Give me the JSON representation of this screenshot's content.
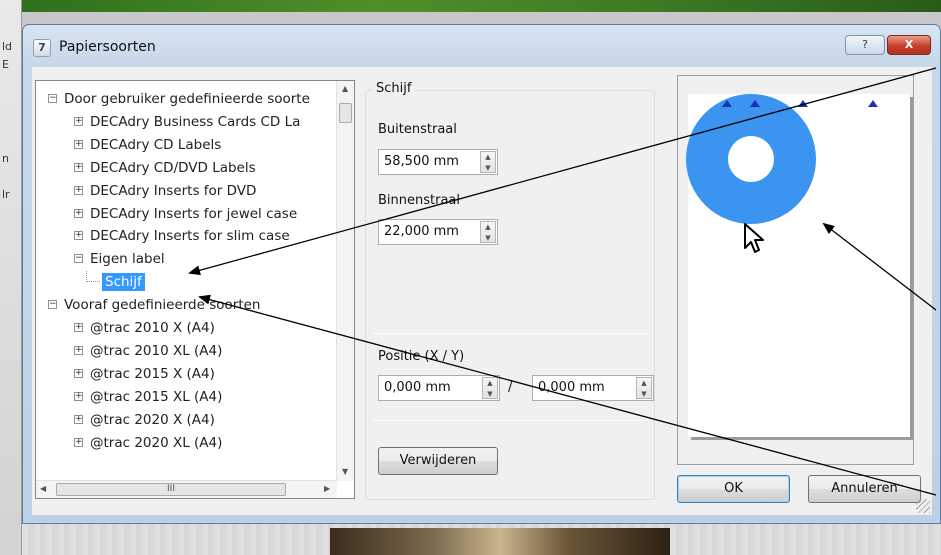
{
  "desktop": {
    "left_fragments": [
      "ld",
      "E",
      "n",
      "lr"
    ]
  },
  "dialog": {
    "title": "Papiersoorten",
    "title_icon": "paper-types-icon",
    "help_label": "?",
    "close_label": "X"
  },
  "tree": {
    "items": [
      {
        "label": "Door gebruiker gedefinieerde soorte",
        "level": 0,
        "expander": "−"
      },
      {
        "label": "DECAdry Business Cards CD La",
        "level": 1,
        "expander": "+"
      },
      {
        "label": "DECAdry CD Labels",
        "level": 1,
        "expander": "+"
      },
      {
        "label": "DECAdry CD/DVD Labels",
        "level": 1,
        "expander": "+"
      },
      {
        "label": "DECAdry Inserts for DVD",
        "level": 1,
        "expander": "+"
      },
      {
        "label": "DECAdry Inserts for jewel case",
        "level": 1,
        "expander": "+"
      },
      {
        "label": "DECAdry Inserts for slim case",
        "level": 1,
        "expander": "+"
      },
      {
        "label": "Eigen label",
        "level": 1,
        "expander": "−"
      },
      {
        "label": "Schijf",
        "level": 2,
        "expander": "",
        "selected": true
      },
      {
        "label": "Vooraf gedefinieerde soorten",
        "level": 0,
        "expander": "−"
      },
      {
        "label": "@trac 2010 X (A4)",
        "level": 1,
        "expander": "+"
      },
      {
        "label": "@trac 2010 XL (A4)",
        "level": 1,
        "expander": "+"
      },
      {
        "label": "@trac 2015 X (A4)",
        "level": 1,
        "expander": "+"
      },
      {
        "label": "@trac 2015 XL (A4)",
        "level": 1,
        "expander": "+"
      },
      {
        "label": "@trac 2020 X (A4)",
        "level": 1,
        "expander": "+"
      },
      {
        "label": "@trac 2020 XL (A4)",
        "level": 1,
        "expander": "+"
      }
    ],
    "hscroll_thumb": "III"
  },
  "properties": {
    "group_title": "Schijf",
    "outer_radius_label": "Buitenstraal",
    "outer_radius_value": "58,500 mm",
    "inner_radius_label": "Binnenstraal",
    "inner_radius_value": "22,000 mm",
    "position_label": "Positie (X / Y)",
    "pos_x_value": "0,000 mm",
    "pos_separator": "/",
    "pos_y_value": "0,000 mm",
    "delete_label": "Verwijderen"
  },
  "buttons": {
    "ok_label": "OK",
    "cancel_label": "Annuleren"
  },
  "colors": {
    "selection": "#3399ff",
    "disc": "#3a94f0",
    "marker": "#1f2db8",
    "close": "#c5402a"
  }
}
